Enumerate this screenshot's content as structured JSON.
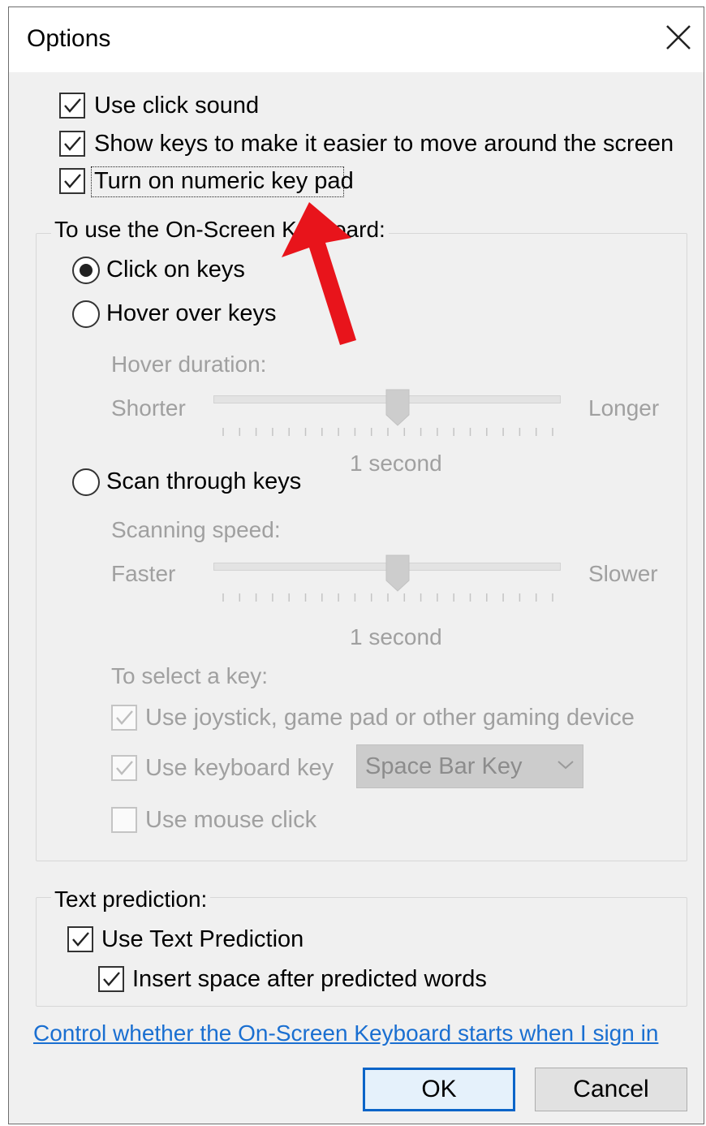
{
  "window": {
    "title": "Options"
  },
  "options": [
    {
      "label": "Use click sound",
      "checked": true
    },
    {
      "label": "Show keys to make it easier to move around the screen",
      "checked": true
    },
    {
      "label": "Turn on numeric key pad",
      "checked": true
    }
  ],
  "keyboard_group": {
    "legend": "To use the On-Screen Keyboard:",
    "modes": [
      {
        "label": "Click on keys",
        "selected": true
      },
      {
        "label": "Hover over keys",
        "selected": false
      },
      {
        "label": "Scan through keys",
        "selected": false
      }
    ],
    "hover": {
      "label": "Hover duration:",
      "min_label": "Shorter",
      "max_label": "Longer",
      "value_text": "1 second",
      "position": 0.53
    },
    "scan": {
      "label": "Scanning speed:",
      "min_label": "Faster",
      "max_label": "Slower",
      "value_text": "1 second",
      "position": 0.53
    },
    "select_key": {
      "label": "To select a key:",
      "options": [
        {
          "label": "Use joystick, game pad or other gaming device",
          "checked": true
        },
        {
          "label": "Use keyboard key",
          "checked": true
        },
        {
          "label": "Use mouse click",
          "checked": false
        }
      ],
      "key_dropdown": "Space Bar Key"
    }
  },
  "prediction_group": {
    "legend": "Text prediction:",
    "options": [
      {
        "label": "Use Text Prediction",
        "checked": true
      },
      {
        "label": "Insert space after predicted words",
        "checked": true
      }
    ]
  },
  "startup_link": "Control whether the On-Screen Keyboard starts when I sign in",
  "buttons": {
    "ok": "OK",
    "cancel": "Cancel"
  },
  "colors": {
    "link": "#1a6fd1",
    "annotation_arrow": "#e8141b",
    "default_button": "#0a64c8"
  }
}
